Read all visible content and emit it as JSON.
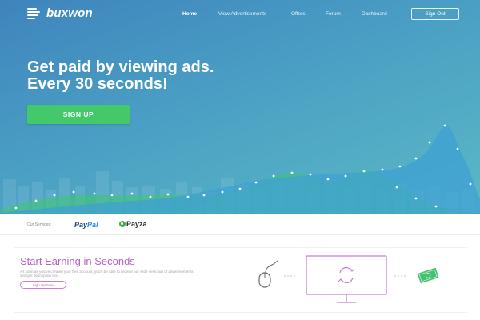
{
  "brand": {
    "name": "buxwon"
  },
  "nav": {
    "items": [
      {
        "label": "Home",
        "active": true
      },
      {
        "label": "View Advertisements",
        "active": false
      },
      {
        "label": "Offers",
        "active": false
      },
      {
        "label": "Forum",
        "active": false
      },
      {
        "label": "Dashboard",
        "active": false
      }
    ],
    "signout_label": "Sign Out"
  },
  "hero": {
    "headline_line1": "Get paid by viewing ads.",
    "headline_line2": "Every 30 seconds!",
    "cta_label": "SIGN UP"
  },
  "services": {
    "label": "Our Services:",
    "paypal_part1": "Pay",
    "paypal_part2": "Pal",
    "payza": "Payza"
  },
  "earn": {
    "title": "Start Earning in Seconds",
    "description": "As soon as you've created your free account, you'll be able to browse our wide selection of advertisements. Sample description text.",
    "button_label": "Sign Up Now"
  },
  "colors": {
    "hero_start": "#3f84bd",
    "hero_end": "#5ab9c6",
    "cta_green": "#43c86a",
    "accent_purple": "#b462c9",
    "cash_green": "#45c16f"
  },
  "icons": {
    "logo": "logo-stripes-icon",
    "payza": "payza-leaf-icon",
    "mouse": "mouse-icon",
    "monitor": "monitor-icon",
    "refresh": "refresh-icon",
    "cash": "cash-icon"
  }
}
